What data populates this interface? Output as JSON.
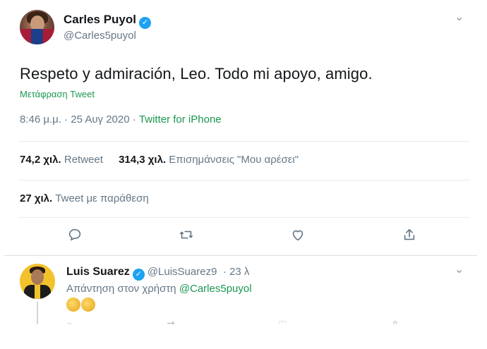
{
  "tweet": {
    "author_name": "Carles Puyol",
    "author_handle": "@Carles5puyol",
    "verified_mark": "✓",
    "text": "Respeto y admiración, Leo. Todo mi apoyo, amigo.",
    "translate_label": "Μετάφραση Tweet",
    "time": "8:46 μ.μ. · 25 Αυγ 2020 · ",
    "source": "Twitter for iPhone",
    "stats": {
      "retweets_count": "74,2 χιλ.",
      "retweets_label": "Retweet",
      "likes_count": "314,3 χιλ.",
      "likes_label": "Επισημάνσεις \"Μου αρέσει\"",
      "quotes_count": "27 χιλ.",
      "quotes_label": "Tweet με παράθεση"
    },
    "icons": {
      "reply": "reply-icon",
      "retweet": "retweet-icon",
      "like": "heart-icon",
      "share": "share-icon",
      "more": "chevron-down-icon"
    }
  },
  "reply": {
    "author_name": "Luis Suarez",
    "author_handle": "@LuisSuarez9",
    "time": "· 23 λ",
    "verified_mark": "✓",
    "replying_to_label": "Απάντηση στον χρήστη ",
    "replying_to_mention": "@Carles5puyol"
  },
  "colors": {
    "accent_link": "#1a9850",
    "verified": "#1da1f2",
    "muted_text": "#657786"
  }
}
